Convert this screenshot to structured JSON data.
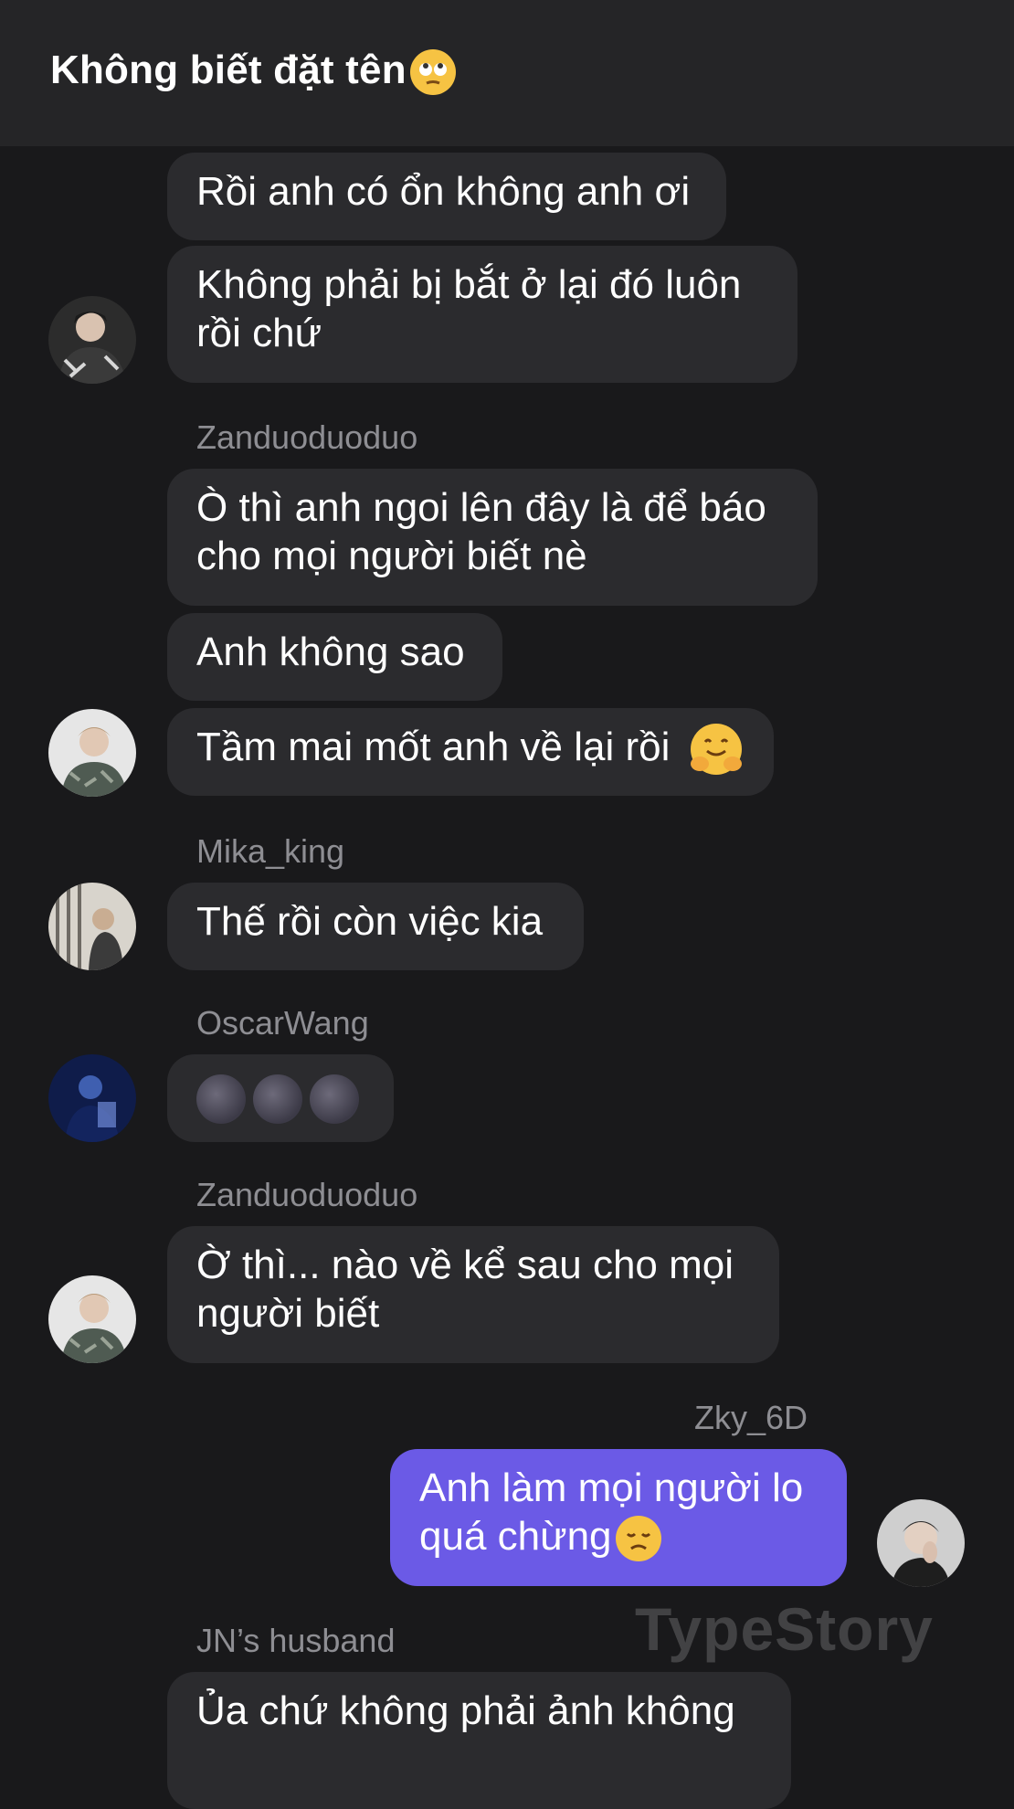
{
  "header": {
    "title": "Không biết đặt tên"
  },
  "messages": [
    {
      "text": "Rồi anh có ổn không anh ơi"
    },
    {
      "line1": "Không phải bị bắt ở lại đó luôn",
      "line2": "rồi chứ"
    },
    {
      "sender": "Zanduoduoduo"
    },
    {
      "line1": "Ò thì anh ngoi lên đây là để báo",
      "line2": "cho mọi người biết nè"
    },
    {
      "text": "Anh không sao"
    },
    {
      "text": "Tầm mai mốt anh về lại rồi"
    },
    {
      "sender": "Mika_king"
    },
    {
      "text": "Thế rồi còn việc kia"
    },
    {
      "sender": "OscarWang"
    },
    {
      "sender": "Zanduoduoduo"
    },
    {
      "line1": "Ờ thì... nào về kể sau cho mọi",
      "line2": "người biết"
    },
    {
      "sender": "Zky_6D"
    },
    {
      "line1": "Anh làm mọi người lo",
      "line2": "quá chừng"
    },
    {
      "sender": "JN’s husband"
    },
    {
      "line1": "Ủa chứ không phải ảnh không"
    }
  ],
  "watermark": "TypeStory",
  "colors": {
    "background": "#19191b",
    "bubble": "#2b2b2e",
    "self_bubble": "#6b5ae6",
    "header": "#252527"
  }
}
